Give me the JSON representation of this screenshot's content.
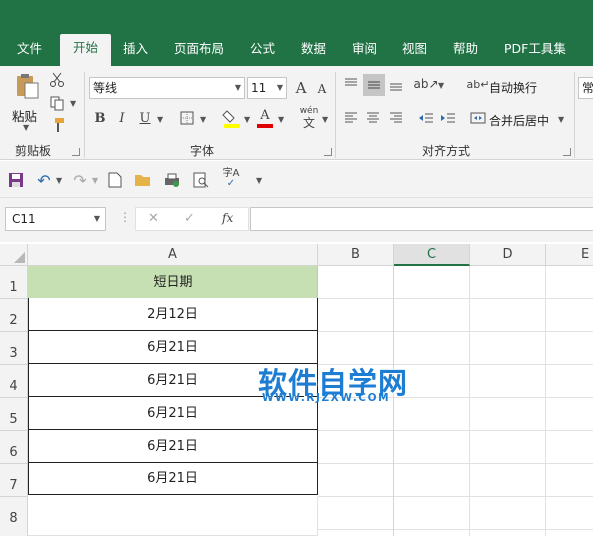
{
  "ribbon_tabs": [
    "文件",
    "开始",
    "插入",
    "页面布局",
    "公式",
    "数据",
    "审阅",
    "视图",
    "帮助",
    "PDF工具集"
  ],
  "active_tab": "开始",
  "clipboard": {
    "paste_label": "粘贴",
    "group_label": "剪贴板"
  },
  "font": {
    "name": "等线",
    "size": "11",
    "group_label": "字体",
    "bold": "B",
    "italic": "I",
    "underline": "U",
    "grow": "A",
    "shrink": "A",
    "font_color": "A",
    "phonetic": "wén"
  },
  "alignment": {
    "wrap_label": "自动换行",
    "merge_label": "合并后居中",
    "group_label": "对齐方式"
  },
  "number_format_partial": "常",
  "qat_icons": [
    "save-icon",
    "undo-icon",
    "redo-icon",
    "new-icon",
    "open-icon",
    "print-preview-icon",
    "preview-icon",
    "spelling-icon",
    "customize-icon"
  ],
  "formula_bar": {
    "name_box": "C11",
    "fx": "fx",
    "cancel": "✕",
    "enter": "✓",
    "value": ""
  },
  "columns": [
    "A",
    "B",
    "C",
    "D",
    "E"
  ],
  "rows": [
    "1",
    "2",
    "3",
    "4",
    "5",
    "6",
    "7",
    "8"
  ],
  "cells": {
    "A1": "短日期",
    "A2": "2月12日",
    "A3": "6月21日",
    "A4": "6月21日",
    "A5": "6月21日",
    "A6": "6月21日",
    "A7": "6月21日"
  },
  "watermark": {
    "title": "软件自学网",
    "url": "WWW.RJZXW.COM"
  },
  "colors": {
    "brand": "#217346",
    "header_fill": "#c6e0b4",
    "font_color_bar": "#e00000",
    "fill_color_bar": "#ffff00",
    "watermark": "#1d7dd3"
  }
}
